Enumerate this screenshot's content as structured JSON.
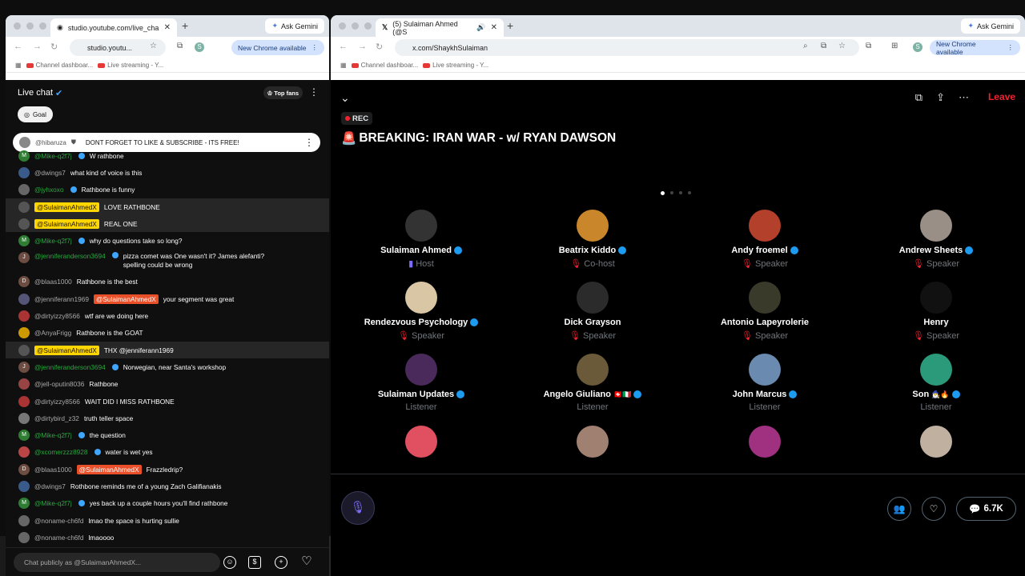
{
  "left_browser": {
    "tab_title": "studio.youtube.com/live_cha",
    "url": "studio.youtu...",
    "gemini": "Ask Gemini",
    "new_chrome": "New Chrome available",
    "bookmarks": [
      "Channel dashboar...",
      "Live streaming - Y..."
    ],
    "profile": "S"
  },
  "right_browser": {
    "tab_title": "(5) Sulaiman Ahmed (@S",
    "url": "x.com/ShaykhSulaiman",
    "gemini": "Ask Gemini",
    "new_chrome": "New Chrome available",
    "bookmarks": [
      "Channel dashboar...",
      "Live streaming - Y..."
    ],
    "profile": "S"
  },
  "chat": {
    "title": "Live chat",
    "top_fans": "Top fans",
    "goal": "Goal",
    "pinned_author": "@hibaruza",
    "pinned_text": "DONT FORGET TO LIKE & SUBSCRIBE - ITS FREE!",
    "input_placeholder": "Chat publicly as @SulaimanAhmedX...",
    "messages": [
      {
        "author": "@Mike-q2f7j",
        "text": "W rathbone",
        "style": "g",
        "av": "M",
        "avc": "#2e7d32"
      },
      {
        "author": "@dwings7",
        "text": "what kind of voice is this",
        "style": "",
        "av": "",
        "avc": "#3a5a8a"
      },
      {
        "author": "@jyhxoxo",
        "text": "Rathbone is funny",
        "style": "g",
        "av": "",
        "avc": "#666"
      },
      {
        "author": "@SulaimanAhmedX",
        "text": "LOVE RATHBONE",
        "style": "owner",
        "av": "",
        "avc": "#555",
        "hl": true
      },
      {
        "author": "@SulaimanAhmedX",
        "text": "REAL ONE",
        "style": "owner",
        "av": "",
        "avc": "#555",
        "hl": true
      },
      {
        "author": "@Mike-q2f7j",
        "text": "why do questions take so long?",
        "style": "g",
        "av": "M",
        "avc": "#2e7d32"
      },
      {
        "author": "@jenniferanderson3694",
        "text": "pizza comet was One wasn't it? James alefanti? spelling could be wrong",
        "style": "g",
        "av": "J",
        "avc": "#6d4c41"
      },
      {
        "author": "@blaas1000",
        "text": "Rathbone is the best",
        "style": "",
        "av": "D",
        "avc": "#6d4c41"
      },
      {
        "author": "@jenniferann1969",
        "mention": "@SulaimanAhmedX",
        "text": "your segment was great",
        "style": "",
        "av": "",
        "avc": "#557"
      },
      {
        "author": "@dirtyizzy8566",
        "text": "wtf are we doing here",
        "style": "",
        "av": "",
        "avc": "#a33"
      },
      {
        "author": "@AnyaFrigg",
        "text": "Rathbone is the GOAT",
        "style": "",
        "av": "",
        "avc": "#c90"
      },
      {
        "author": "@SulaimanAhmedX",
        "text": "THX @jenniferann1969",
        "style": "owner",
        "av": "",
        "avc": "#555",
        "hl": true
      },
      {
        "author": "@jenniferanderson3694",
        "text": "Norwegian, near Santa's workshop",
        "style": "g",
        "av": "J",
        "avc": "#6d4c41"
      },
      {
        "author": "@jell-oputin8036",
        "text": "Rathbone",
        "style": "",
        "av": "",
        "avc": "#944"
      },
      {
        "author": "@dirtyizzy8566",
        "text": "WAIT DID I MISS RATHBONE",
        "style": "",
        "av": "",
        "avc": "#a33"
      },
      {
        "author": "@dirtybird_z32",
        "text": "truth teller space",
        "style": "",
        "av": "",
        "avc": "#777"
      },
      {
        "author": "@Mike-q2f7j",
        "text": "the question",
        "style": "g",
        "av": "M",
        "avc": "#2e7d32"
      },
      {
        "author": "@xcomerzzz8928",
        "text": "water is wet yes",
        "style": "g",
        "av": "",
        "avc": "#b44"
      },
      {
        "author": "@blaas1000",
        "mention": "@SulaimanAhmedX",
        "text": "Frazzledrip?",
        "style": "",
        "av": "D",
        "avc": "#6d4c41"
      },
      {
        "author": "@dwings7",
        "text": "Rothbone reminds me of a young Zach Galifianakis",
        "style": "",
        "av": "",
        "avc": "#3a5a8a"
      },
      {
        "author": "@Mike-q2f7j",
        "text": "yes back up a couple hours you'll find rathbone",
        "style": "g",
        "av": "M",
        "avc": "#2e7d32"
      },
      {
        "author": "@noname-ch6fd",
        "text": "lmao the space is hurting sullie",
        "style": "",
        "av": "",
        "avc": "#666"
      },
      {
        "author": "@noname-ch6fd",
        "text": "lmaoooo",
        "style": "",
        "av": "",
        "avc": "#666"
      }
    ]
  },
  "space": {
    "rec": "REC",
    "title": "BREAKING: IRAN WAR - w/ RYAN DAWSON",
    "leave": "Leave",
    "count": "6.7K",
    "participants": [
      {
        "name": "Sulaiman Ahmed",
        "role": "Host",
        "verified": true,
        "col": "#333"
      },
      {
        "name": "Beatrix Kiddo",
        "role": "Co-host",
        "verified": true,
        "col": "#c9862b"
      },
      {
        "name": "Andy froemel",
        "role": "Speaker",
        "verified": true,
        "col": "#b3402a"
      },
      {
        "name": "Andrew Sheets",
        "role": "Speaker",
        "verified": true,
        "col": "#9a8f86"
      },
      {
        "name": "Rendezvous Psychology",
        "role": "Speaker",
        "verified": true,
        "col": "#d9c6a5"
      },
      {
        "name": "Dick Grayson",
        "role": "Speaker",
        "verified": false,
        "col": "#2b2b2b"
      },
      {
        "name": "Antonio Lapeyrolerie",
        "role": "Speaker",
        "verified": false,
        "col": "#3a3a2a"
      },
      {
        "name": "Henry",
        "role": "Speaker",
        "verified": false,
        "col": "#111"
      },
      {
        "name": "Sulaiman Updates",
        "role": "Listener",
        "verified": true,
        "col": "#4a2a5a"
      },
      {
        "name": "Angelo Giuliano",
        "role": "Listener",
        "verified": true,
        "col": "#6b5a3a",
        "flags": "🇨🇭🇮🇹"
      },
      {
        "name": "John Marcus",
        "role": "Listener",
        "verified": true,
        "col": "#6a8ab0"
      },
      {
        "name": "Son",
        "role": "Listener",
        "verified": true,
        "col": "#2a9a7a",
        "emoji": "🧙‍♂️🔥"
      },
      {
        "name": "",
        "role": "",
        "verified": false,
        "col": "#e05060"
      },
      {
        "name": "",
        "role": "",
        "verified": false,
        "col": "#a08070"
      },
      {
        "name": "",
        "role": "",
        "verified": false,
        "col": "#a03080"
      },
      {
        "name": "",
        "role": "",
        "verified": false,
        "col": "#c0b0a0"
      }
    ]
  }
}
